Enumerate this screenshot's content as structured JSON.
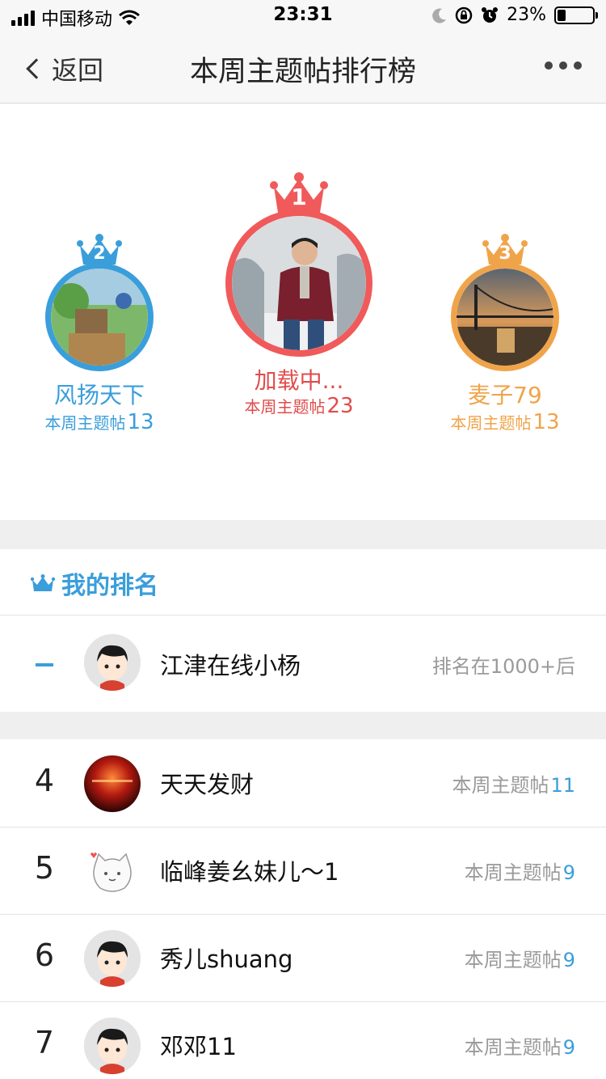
{
  "status_bar": {
    "carrier": "中国移动",
    "time": "23:31",
    "battery_percent": "23%",
    "battery_level": 0.23
  },
  "nav": {
    "back_label": "返回",
    "title": "本周主题帖排行榜",
    "more_icon": "ellipsis-icon"
  },
  "podium": {
    "colors": {
      "first": "#f05a5a",
      "second": "#3a9edb",
      "third": "#f0a44a"
    },
    "winners": [
      {
        "rank": "1",
        "name": "加载中...",
        "count_label": "本周主题帖",
        "count": "23"
      },
      {
        "rank": "2",
        "name": "风扬天下",
        "count_label": "本周主题帖",
        "count": "13"
      },
      {
        "rank": "3",
        "name": "麦子79",
        "count_label": "本周主题帖",
        "count": "13"
      }
    ]
  },
  "my_rank": {
    "header": "我的排名",
    "rank": "–",
    "name": "江津在线小杨",
    "status": "排名在1000+后"
  },
  "list": [
    {
      "rank": "4",
      "name": "天天发财",
      "count_label": "本周主题帖",
      "count": "11"
    },
    {
      "rank": "5",
      "name": "临峰姜幺妹儿～1",
      "count_label": "本周主题帖",
      "count": "9"
    },
    {
      "rank": "6",
      "name": "秀儿shuang",
      "count_label": "本周主题帖",
      "count": "9"
    },
    {
      "rank": "7",
      "name": "邓邓11",
      "count_label": "本周主题帖",
      "count": "9"
    }
  ],
  "accent_color": "#3a9edb"
}
